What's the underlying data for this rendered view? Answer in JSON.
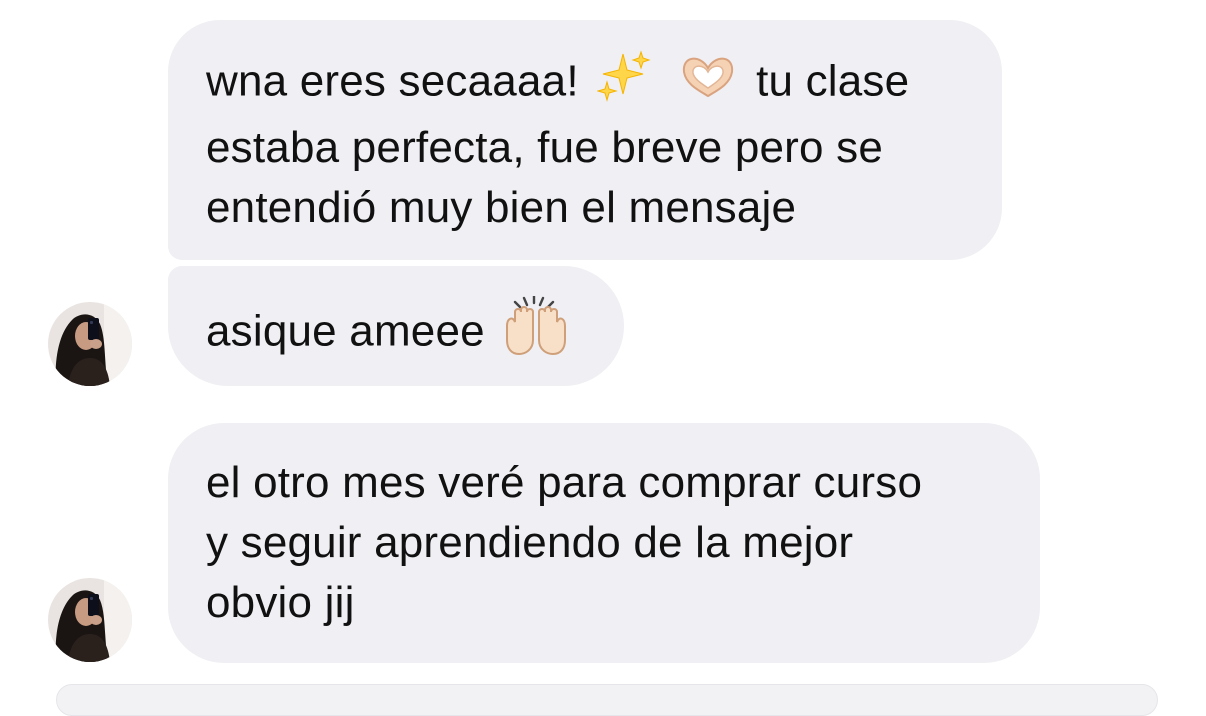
{
  "messages": [
    {
      "lines": [
        {
          "before": "wna eres secaaaa!",
          "after": "tu clase"
        },
        {
          "text": "estaba perfecta, fue breve pero se"
        },
        {
          "text": "entendió muy bien el mensaje"
        }
      ],
      "emojis": [
        "sparkles-emoji",
        "heart-hands-emoji"
      ]
    },
    {
      "text": "asique ameee",
      "emojis": [
        "raising-hands-emoji"
      ]
    },
    {
      "lines": [
        "el otro mes veré para comprar curso",
        "y seguir aprendiendo de la mejor",
        "obvio jij"
      ]
    }
  ],
  "colors": {
    "bubble": "#efeff4",
    "text": "#111111",
    "background": "#ffffff"
  }
}
